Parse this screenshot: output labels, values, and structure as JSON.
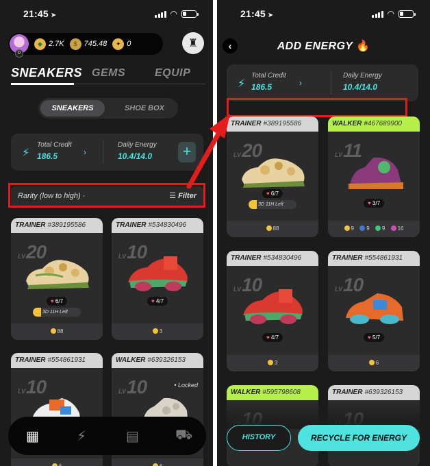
{
  "status": {
    "time": "21:45"
  },
  "left": {
    "header": {
      "avatar_level": "0",
      "gems": "2.7K",
      "gold": "745.48",
      "stars": "0"
    },
    "tabs": [
      "SNEAKERS",
      "GEMS",
      "EQUIP"
    ],
    "segment": [
      "SNEAKERS",
      "SHOE BOX"
    ],
    "credit": {
      "total_label": "Total Credit",
      "total_value": "186.5",
      "daily_label": "Daily Energy",
      "daily_value": "10.4/14.0",
      "plus": "+"
    },
    "sort": {
      "label": "Rarity (low to high) ·",
      "filter": "Filter"
    },
    "cards": [
      {
        "type": "TRAINER",
        "id": "#389195586",
        "lv_prefix": "LV",
        "level": "20",
        "lives": "6/7",
        "timer": "3D 11H Left",
        "foot": "88"
      },
      {
        "type": "TRAINER",
        "id": "#534830496",
        "lv_prefix": "LV",
        "level": "10",
        "lives": "4/7",
        "foot": "3"
      },
      {
        "type": "TRAINER",
        "id": "#554861931",
        "lv_prefix": "LV",
        "level": "10",
        "foot": "6"
      },
      {
        "type": "WALKER",
        "id": "#639326153",
        "lv_prefix": "LV",
        "level": "10",
        "locked": "• Locked",
        "foot": "6"
      }
    ]
  },
  "right": {
    "title": "ADD ENERGY",
    "credit": {
      "total_label": "Total Credit",
      "total_value": "186.5",
      "daily_label": "Daily Energy",
      "daily_value": "10.4/14.0"
    },
    "cards": [
      {
        "type": "TRAINER",
        "id": "#389195586",
        "lv_prefix": "LV",
        "level": "20",
        "lives": "6/7",
        "timer": "3D 11H Left",
        "foot": "88"
      },
      {
        "type": "WALKER",
        "id": "#467689900",
        "lv_prefix": "LV",
        "level": "11",
        "lives": "3/7",
        "stats": [
          "9",
          "9",
          "9",
          "16"
        ]
      },
      {
        "type": "TRAINER",
        "id": "#534830496",
        "lv_prefix": "LV",
        "level": "10",
        "lives": "4/7",
        "foot": "3"
      },
      {
        "type": "TRAINER",
        "id": "#554861931",
        "lv_prefix": "LV",
        "level": "10",
        "lives": "5/7",
        "foot": "6"
      },
      {
        "type": "WALKER",
        "id": "#595798608",
        "lv_prefix": "LV",
        "level": "10"
      },
      {
        "type": "TRAINER",
        "id": "#639326153",
        "lv_prefix": "LV",
        "level": "10"
      }
    ],
    "buttons": {
      "history": "HISTORY",
      "recycle": "RECYCLE FOR ENERGY"
    }
  },
  "colors": {
    "accent": "#4fe3e0",
    "highlight": "#e41c1c",
    "walker": "#b8f04a",
    "trainer": "#d6d6d6"
  }
}
